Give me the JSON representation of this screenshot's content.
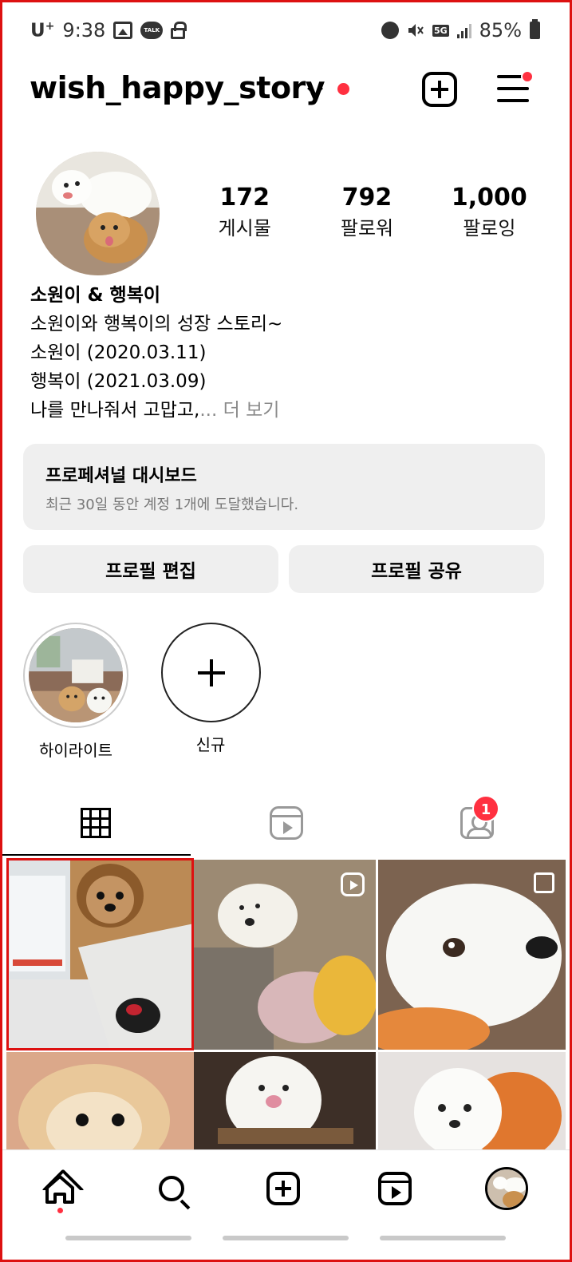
{
  "status_bar": {
    "carrier": "U",
    "carrier_sup": "+",
    "time": "9:38",
    "network": "5G",
    "battery": "85%"
  },
  "header": {
    "username": "wish_happy_story"
  },
  "profile": {
    "stats": [
      {
        "value": "172",
        "label": "게시물"
      },
      {
        "value": "792",
        "label": "팔로워"
      },
      {
        "value": "1,000",
        "label": "팔로잉"
      }
    ],
    "bio": {
      "name": "소원이 & 행복이",
      "lines": [
        "소원이와 행복이의 성장 스토리~",
        "소원이 (2020.03.11)",
        "행복이 (2021.03.09)"
      ],
      "last_line": "나를 만나줘서 고맙고,",
      "more": "... 더 보기"
    }
  },
  "dashboard": {
    "title": "프로페셔널 대시보드",
    "subtitle": "최근 30일 동안 계정 1개에 도달했습니다."
  },
  "buttons": {
    "edit": "프로필 편집",
    "share": "프로필 공유"
  },
  "highlights": [
    {
      "label": "하이라이트"
    },
    {
      "label": "신규"
    }
  ],
  "tabs": {
    "tagged_badge": "1"
  },
  "colors": {
    "accent": "#ff3040",
    "button_bg": "#efefef",
    "selection_frame": "#dd1111"
  },
  "icons": {
    "header": [
      "chevron-down-icon",
      "create-post-icon",
      "menu-icon"
    ],
    "tabs": [
      "grid-icon",
      "reels-icon",
      "tagged-icon"
    ],
    "nav": [
      "home-icon",
      "search-icon",
      "create-icon",
      "reels-icon",
      "profile-avatar"
    ]
  }
}
